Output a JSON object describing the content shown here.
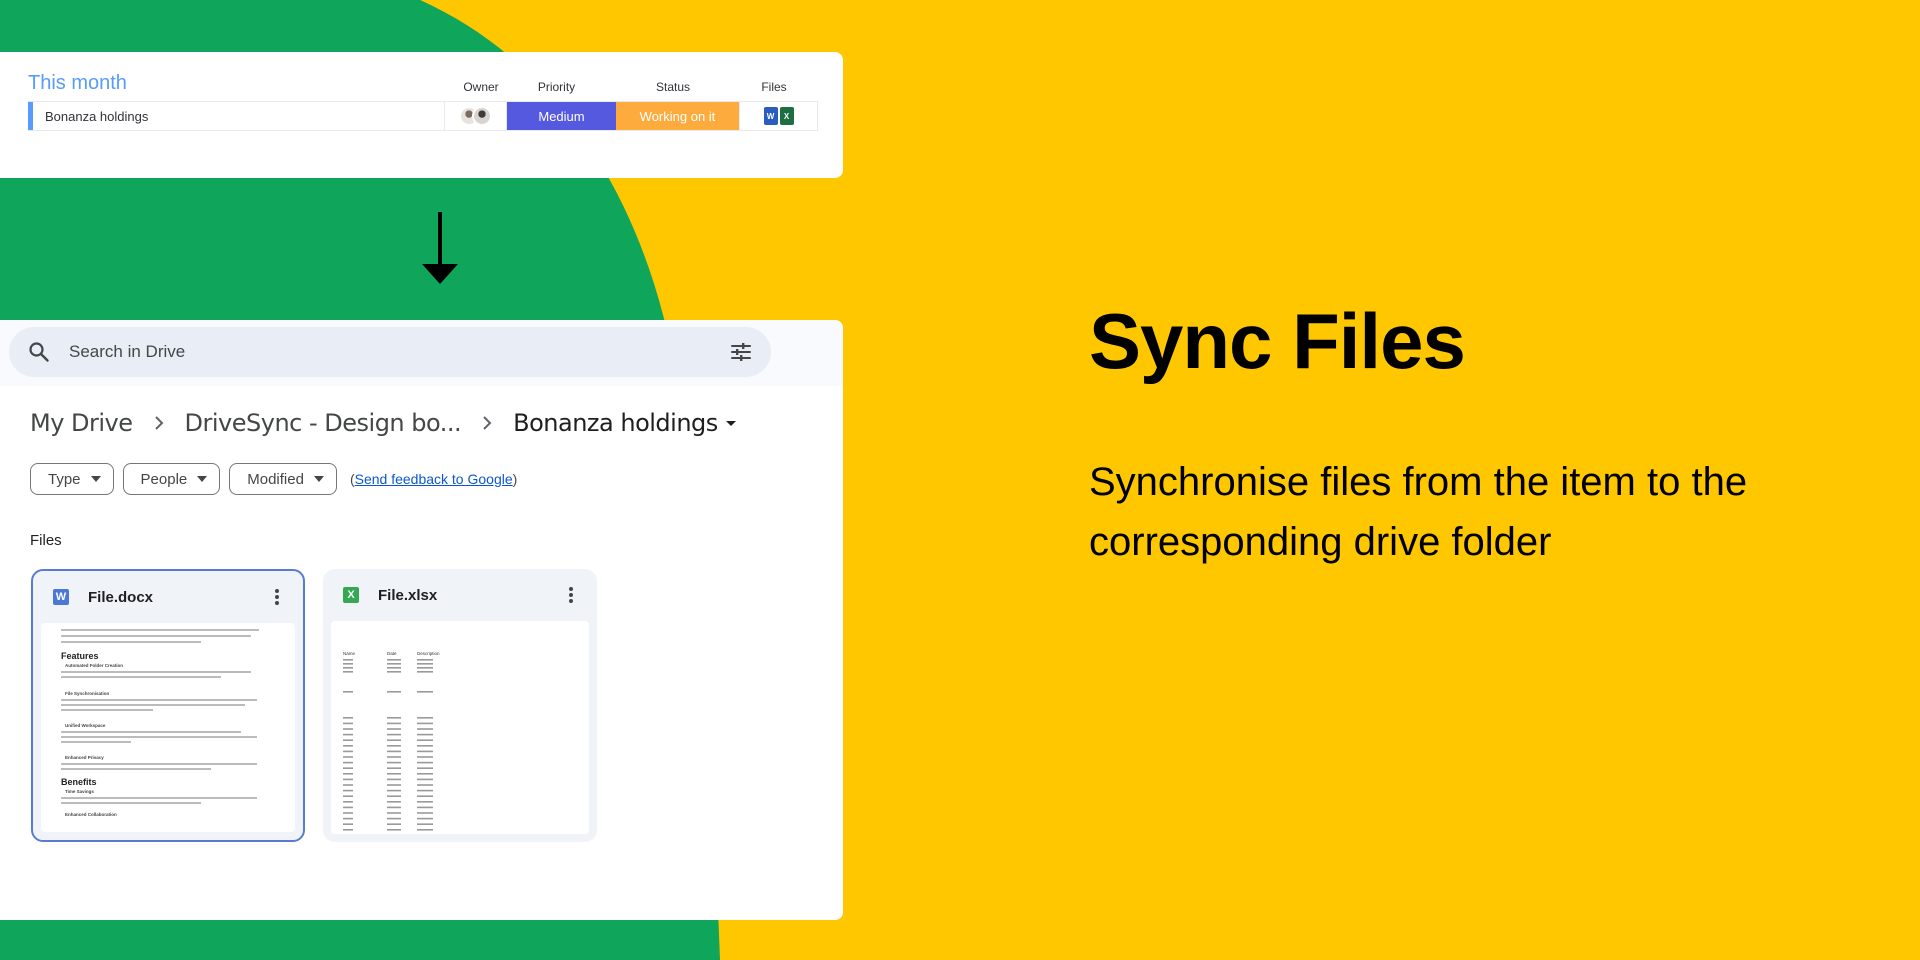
{
  "theme": {
    "background": "#ffc700",
    "green": "#0fa55a",
    "board_accent": "#579bfc",
    "priority_color": "#5559df",
    "status_color": "#fdab3d",
    "word_color": "#2b5cbf",
    "excel_color": "#1d6f42"
  },
  "board": {
    "group_title": "This month",
    "columns": {
      "owner": "Owner",
      "priority": "Priority",
      "status": "Status",
      "files": "Files"
    },
    "row": {
      "name": "Bonanza holdings",
      "priority": "Medium",
      "status": "Working on it",
      "file_icons": [
        "W",
        "X"
      ]
    }
  },
  "drive": {
    "search_placeholder": "Search in Drive",
    "breadcrumb": [
      "My Drive",
      "DriveSync - Design bo...",
      "Bonanza holdings"
    ],
    "filters": [
      "Type",
      "People",
      "Modified"
    ],
    "feedback_open": "(",
    "feedback_link": "Send feedback to Google",
    "feedback_close": ")",
    "files_label": "Files",
    "files": [
      {
        "name": "File.docx",
        "type_letter": "W"
      },
      {
        "name": "File.xlsx",
        "type_letter": "X"
      }
    ],
    "docx_preview": {
      "intro": "Drivesync integrates monday.com with Google Drive, automating folder creation and file synchronisation between the platforms. Ideal for project managers, designers, content creators, and educators, it simplifies workflow, enhances collaboration.",
      "features_heading": "Features",
      "features": [
        "Automated Folder Creation",
        "File Synchronisation",
        "Unified Workspace",
        "Enhanced Privacy"
      ],
      "benefits_heading": "Benefits",
      "benefits": [
        "Time Savings",
        "Enhanced Collaboration"
      ]
    },
    "xlsx_preview": {
      "headers": [
        "Name",
        "Date",
        "Description"
      ]
    }
  },
  "headline": "Sync Files",
  "subline": "Synchronise files from the item to the corresponding drive folder"
}
